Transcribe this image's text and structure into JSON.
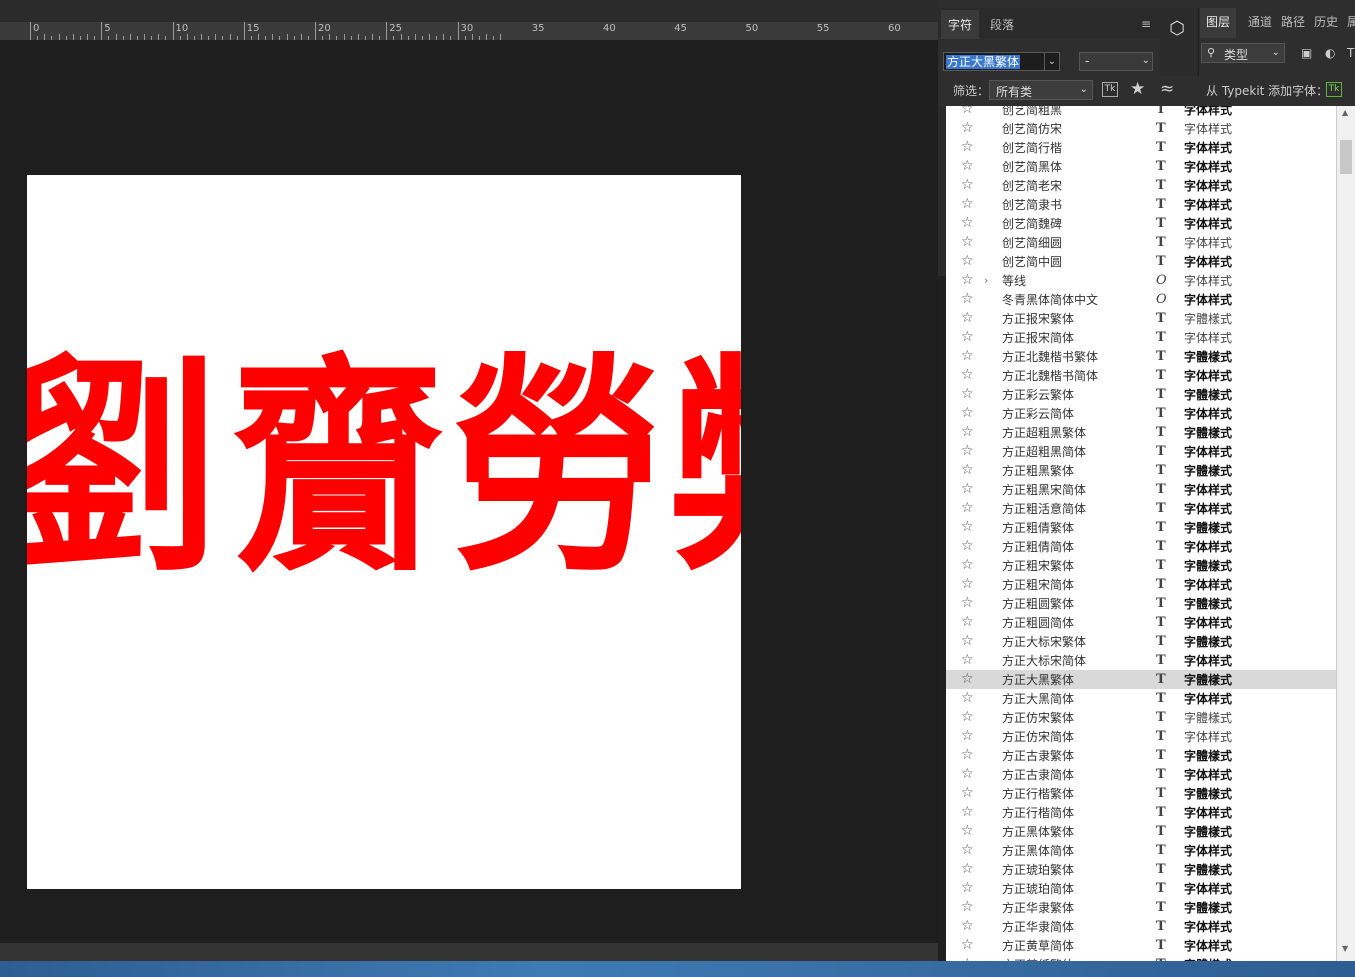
{
  "ruler": {
    "labels": [
      "0",
      "5",
      "10",
      "15",
      "20",
      "25",
      "30",
      "35",
      "40",
      "45",
      "50",
      "55",
      "60"
    ]
  },
  "canvas": {
    "glyphs": [
      "劉",
      "齎",
      "勞",
      "弊"
    ],
    "text_color": "#ff0000"
  },
  "char_panel": {
    "tabs": [
      "字符",
      "段落"
    ],
    "font_family": "方正大黑繁体",
    "font_style": "-"
  },
  "layers_panel": {
    "tabs": [
      "图层",
      "通道",
      "路径",
      "历史",
      "属"
    ],
    "search_type": "类型"
  },
  "filter_bar": {
    "label": "筛选：",
    "category": "所有类",
    "tk_label": "Tk",
    "typekit_label": "从 Typekit 添加字体：",
    "typekit_icon": "Tk"
  },
  "font_list": [
    {
      "name": "创艺简粗黑",
      "icon": "T",
      "sample": "字体样式",
      "bold": true
    },
    {
      "name": "创艺简仿宋",
      "icon": "T",
      "sample": "字体样式",
      "bold": false
    },
    {
      "name": "创艺简行楷",
      "icon": "T",
      "sample": "字体样式",
      "bold": true
    },
    {
      "name": "创艺简黑体",
      "icon": "T",
      "sample": "字体样式",
      "bold": true
    },
    {
      "name": "创艺简老宋",
      "icon": "T",
      "sample": "字体样式",
      "bold": true
    },
    {
      "name": "创艺简隶书",
      "icon": "T",
      "sample": "字体样式",
      "bold": true
    },
    {
      "name": "创艺简魏碑",
      "icon": "T",
      "sample": "字体样式",
      "bold": true
    },
    {
      "name": "创艺简细圆",
      "icon": "T",
      "sample": "字体样式",
      "bold": false
    },
    {
      "name": "创艺简中圆",
      "icon": "T",
      "sample": "字体样式",
      "bold": true
    },
    {
      "name": "等线",
      "icon": "O",
      "sample": "字体样式",
      "bold": false,
      "expand": true
    },
    {
      "name": "冬青黑体简体中文",
      "icon": "O",
      "sample": "字体样式",
      "bold": true
    },
    {
      "name": "方正报宋繁体",
      "icon": "T",
      "sample": "字體樣式",
      "bold": false
    },
    {
      "name": "方正报宋简体",
      "icon": "T",
      "sample": "字体样式",
      "bold": false
    },
    {
      "name": "方正北魏楷书繁体",
      "icon": "T",
      "sample": "字體樣式",
      "bold": true
    },
    {
      "name": "方正北魏楷书简体",
      "icon": "T",
      "sample": "字体样式",
      "bold": true
    },
    {
      "name": "方正彩云繁体",
      "icon": "T",
      "sample": "字體樣式",
      "bold": true
    },
    {
      "name": "方正彩云简体",
      "icon": "T",
      "sample": "字体样式",
      "bold": true
    },
    {
      "name": "方正超粗黑繁体",
      "icon": "T",
      "sample": "字體樣式",
      "bold": true
    },
    {
      "name": "方正超粗黑简体",
      "icon": "T",
      "sample": "字体样式",
      "bold": true
    },
    {
      "name": "方正粗黑繁体",
      "icon": "T",
      "sample": "字體樣式",
      "bold": true
    },
    {
      "name": "方正粗黑宋简体",
      "icon": "T",
      "sample": "字体样式",
      "bold": true
    },
    {
      "name": "方正粗活意简体",
      "icon": "T",
      "sample": "字体样式",
      "bold": true
    },
    {
      "name": "方正粗倩繁体",
      "icon": "T",
      "sample": "字體樣式",
      "bold": true
    },
    {
      "name": "方正粗倩简体",
      "icon": "T",
      "sample": "字体样式",
      "bold": true
    },
    {
      "name": "方正粗宋繁体",
      "icon": "T",
      "sample": "字體樣式",
      "bold": true
    },
    {
      "name": "方正粗宋简体",
      "icon": "T",
      "sample": "字体样式",
      "bold": true
    },
    {
      "name": "方正粗圆繁体",
      "icon": "T",
      "sample": "字體樣式",
      "bold": true
    },
    {
      "name": "方正粗圆简体",
      "icon": "T",
      "sample": "字体样式",
      "bold": true
    },
    {
      "name": "方正大标宋繁体",
      "icon": "T",
      "sample": "字體樣式",
      "bold": true
    },
    {
      "name": "方正大标宋简体",
      "icon": "T",
      "sample": "字体样式",
      "bold": true
    },
    {
      "name": "方正大黑繁体",
      "icon": "T",
      "sample": "字體樣式",
      "bold": true,
      "selected": true
    },
    {
      "name": "方正大黑简体",
      "icon": "T",
      "sample": "字体样式",
      "bold": true
    },
    {
      "name": "方正仿宋繁体",
      "icon": "T",
      "sample": "字體樣式",
      "bold": false
    },
    {
      "name": "方正仿宋简体",
      "icon": "T",
      "sample": "字体样式",
      "bold": false
    },
    {
      "name": "方正古隶繁体",
      "icon": "T",
      "sample": "字體樣式",
      "bold": true
    },
    {
      "name": "方正古隶简体",
      "icon": "T",
      "sample": "字体样式",
      "bold": true
    },
    {
      "name": "方正行楷繁体",
      "icon": "T",
      "sample": "字體樣式",
      "bold": true
    },
    {
      "name": "方正行楷简体",
      "icon": "T",
      "sample": "字体样式",
      "bold": true
    },
    {
      "name": "方正黑体繁体",
      "icon": "T",
      "sample": "字體樣式",
      "bold": true
    },
    {
      "name": "方正黑体简体",
      "icon": "T",
      "sample": "字体样式",
      "bold": true
    },
    {
      "name": "方正琥珀繁体",
      "icon": "T",
      "sample": "字體樣式",
      "bold": true
    },
    {
      "name": "方正琥珀简体",
      "icon": "T",
      "sample": "字体样式",
      "bold": true
    },
    {
      "name": "方正华隶繁体",
      "icon": "T",
      "sample": "字體樣式",
      "bold": true
    },
    {
      "name": "方正华隶简体",
      "icon": "T",
      "sample": "字体样式",
      "bold": true
    },
    {
      "name": "方正黄草简体",
      "icon": "T",
      "sample": "字体样式",
      "bold": true
    },
    {
      "name": "方正剪纸繁体",
      "icon": "T",
      "sample": "字體樣式",
      "bold": true
    }
  ]
}
